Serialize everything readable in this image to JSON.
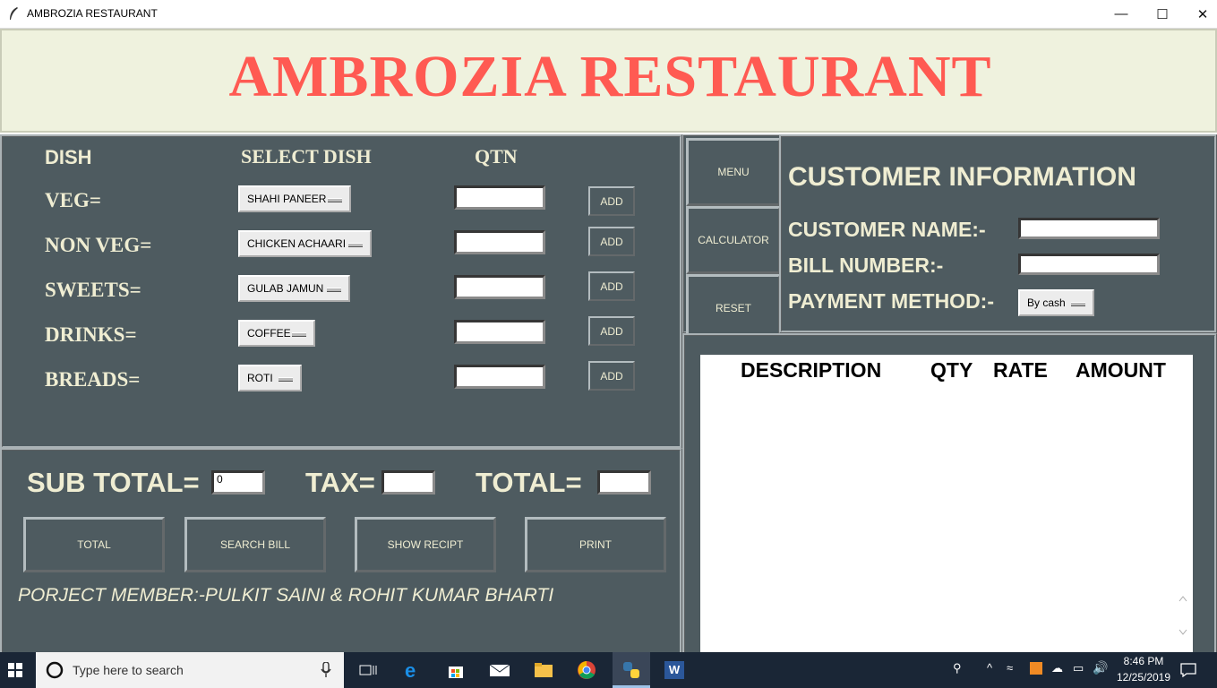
{
  "window": {
    "title": "AMBROZIA RESTAURANT",
    "minimize": "—",
    "maximize": "☐",
    "close": "✕"
  },
  "banner": {
    "title": "AMBROZIA RESTAURANT"
  },
  "order_panel": {
    "headers": {
      "dish": "DISH",
      "select": "SELECT DISH",
      "qty": "QTN"
    },
    "rows": [
      {
        "label": "VEG=",
        "selected": "SHAHI PANEER",
        "qty": "",
        "add": "ADD"
      },
      {
        "label": "NON VEG=",
        "selected": "CHICKEN ACHAARI",
        "qty": "",
        "add": "ADD"
      },
      {
        "label": "SWEETS=",
        "selected": "GULAB JAMUN",
        "qty": "",
        "add": "ADD"
      },
      {
        "label": "DRINKS=",
        "selected": "COFFEE",
        "qty": "",
        "add": "ADD"
      },
      {
        "label": "BREADS=",
        "selected": "ROTI",
        "qty": "",
        "add": "ADD"
      }
    ]
  },
  "totals_panel": {
    "subtotal_label": "SUB TOTAL=",
    "subtotal_value": "0",
    "tax_label": "TAX=",
    "tax_value": "",
    "total_label": "TOTAL=",
    "total_value": "",
    "buttons": {
      "total": "TOTAL",
      "search": "SEARCH BILL",
      "show": "SHOW RECIPT",
      "print": "PRINT"
    },
    "members": "PORJECT MEMBER:-PULKIT SAINI & ROHIT KUMAR BHARTI"
  },
  "side_buttons": {
    "menu": "MENU",
    "calculator": "CALCULATOR",
    "reset": "RESET"
  },
  "customer": {
    "heading": "CUSTOMER INFORMATION",
    "name_label": "CUSTOMER NAME:-",
    "name_value": "",
    "bill_label": "BILL NUMBER:-",
    "bill_value": "",
    "payment_label": "PAYMENT METHOD:-",
    "payment_value": "By cash"
  },
  "bill": {
    "columns": [
      "DESCRIPTION",
      "QTY",
      "RATE",
      "AMOUNT"
    ]
  },
  "taskbar": {
    "search_placeholder": "Type here to search",
    "time": "8:46 PM",
    "date": "12/25/2019",
    "word_icon_letter": "W"
  },
  "colors": {
    "panel": "#4e5b60",
    "title": "#ff5a52",
    "banner": "#eff2de",
    "text": "#efedd2"
  }
}
